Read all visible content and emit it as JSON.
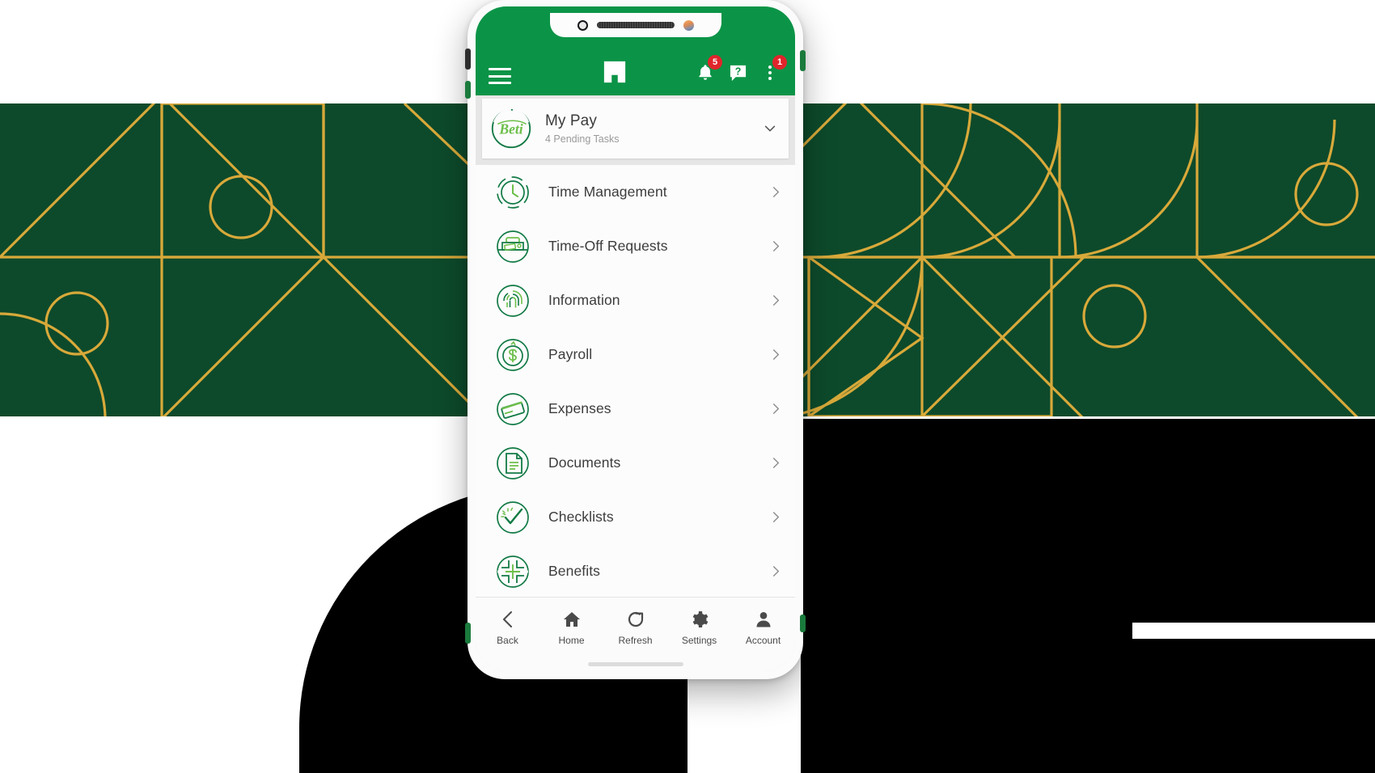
{
  "device": {
    "notch": {
      "camera": "front-camera-dot",
      "speaker": "earpiece-speaker",
      "sensor": "proximity-sensor"
    }
  },
  "colors": {
    "header_green": "#0b9447",
    "pattern_bg_green": "#0d4a2b",
    "pattern_line_gold": "#d8a93a",
    "badge_red": "#e0252b",
    "icon_green_dark": "#127a45",
    "icon_green_light": "#6cbf4a",
    "text_primary": "#3c3c3c",
    "text_muted": "#9a9a9a"
  },
  "header": {
    "menu_icon": "hamburger-icon",
    "brand_icon": "paycom-logo-icon",
    "notifications": {
      "icon": "bell-icon",
      "badge": "5"
    },
    "help": {
      "icon": "question-mark-icon"
    },
    "overflow": {
      "icon": "kebab-menu-icon",
      "badge": "1"
    }
  },
  "mypay_card": {
    "logo_icon": "beti-logo-icon",
    "logo_text": "Beti",
    "title": "My Pay",
    "subtitle": "4 Pending Tasks",
    "expand_icon": "chevron-down-icon"
  },
  "menu": {
    "items": [
      {
        "label": "Time Management",
        "icon": "clock-icon",
        "chevron": "chevron-right-icon"
      },
      {
        "label": "Time-Off Requests",
        "icon": "suitcase-icon",
        "chevron": "chevron-right-icon"
      },
      {
        "label": "Information",
        "icon": "fingerprint-icon",
        "chevron": "chevron-right-icon"
      },
      {
        "label": "Payroll",
        "icon": "dollar-coin-icon",
        "chevron": "chevron-right-icon"
      },
      {
        "label": "Expenses",
        "icon": "credit-card-icon",
        "chevron": "chevron-right-icon"
      },
      {
        "label": "Documents",
        "icon": "document-icon",
        "chevron": "chevron-right-icon"
      },
      {
        "label": "Checklists",
        "icon": "check-circle-icon",
        "chevron": "chevron-right-icon"
      },
      {
        "label": "Benefits",
        "icon": "medical-cross-icon",
        "chevron": "chevron-right-icon"
      }
    ]
  },
  "bottom_nav": {
    "items": [
      {
        "label": "Back",
        "icon": "chevron-left-icon"
      },
      {
        "label": "Home",
        "icon": "home-icon"
      },
      {
        "label": "Refresh",
        "icon": "refresh-icon"
      },
      {
        "label": "Settings",
        "icon": "gear-icon"
      },
      {
        "label": "Account",
        "icon": "person-icon"
      }
    ]
  }
}
